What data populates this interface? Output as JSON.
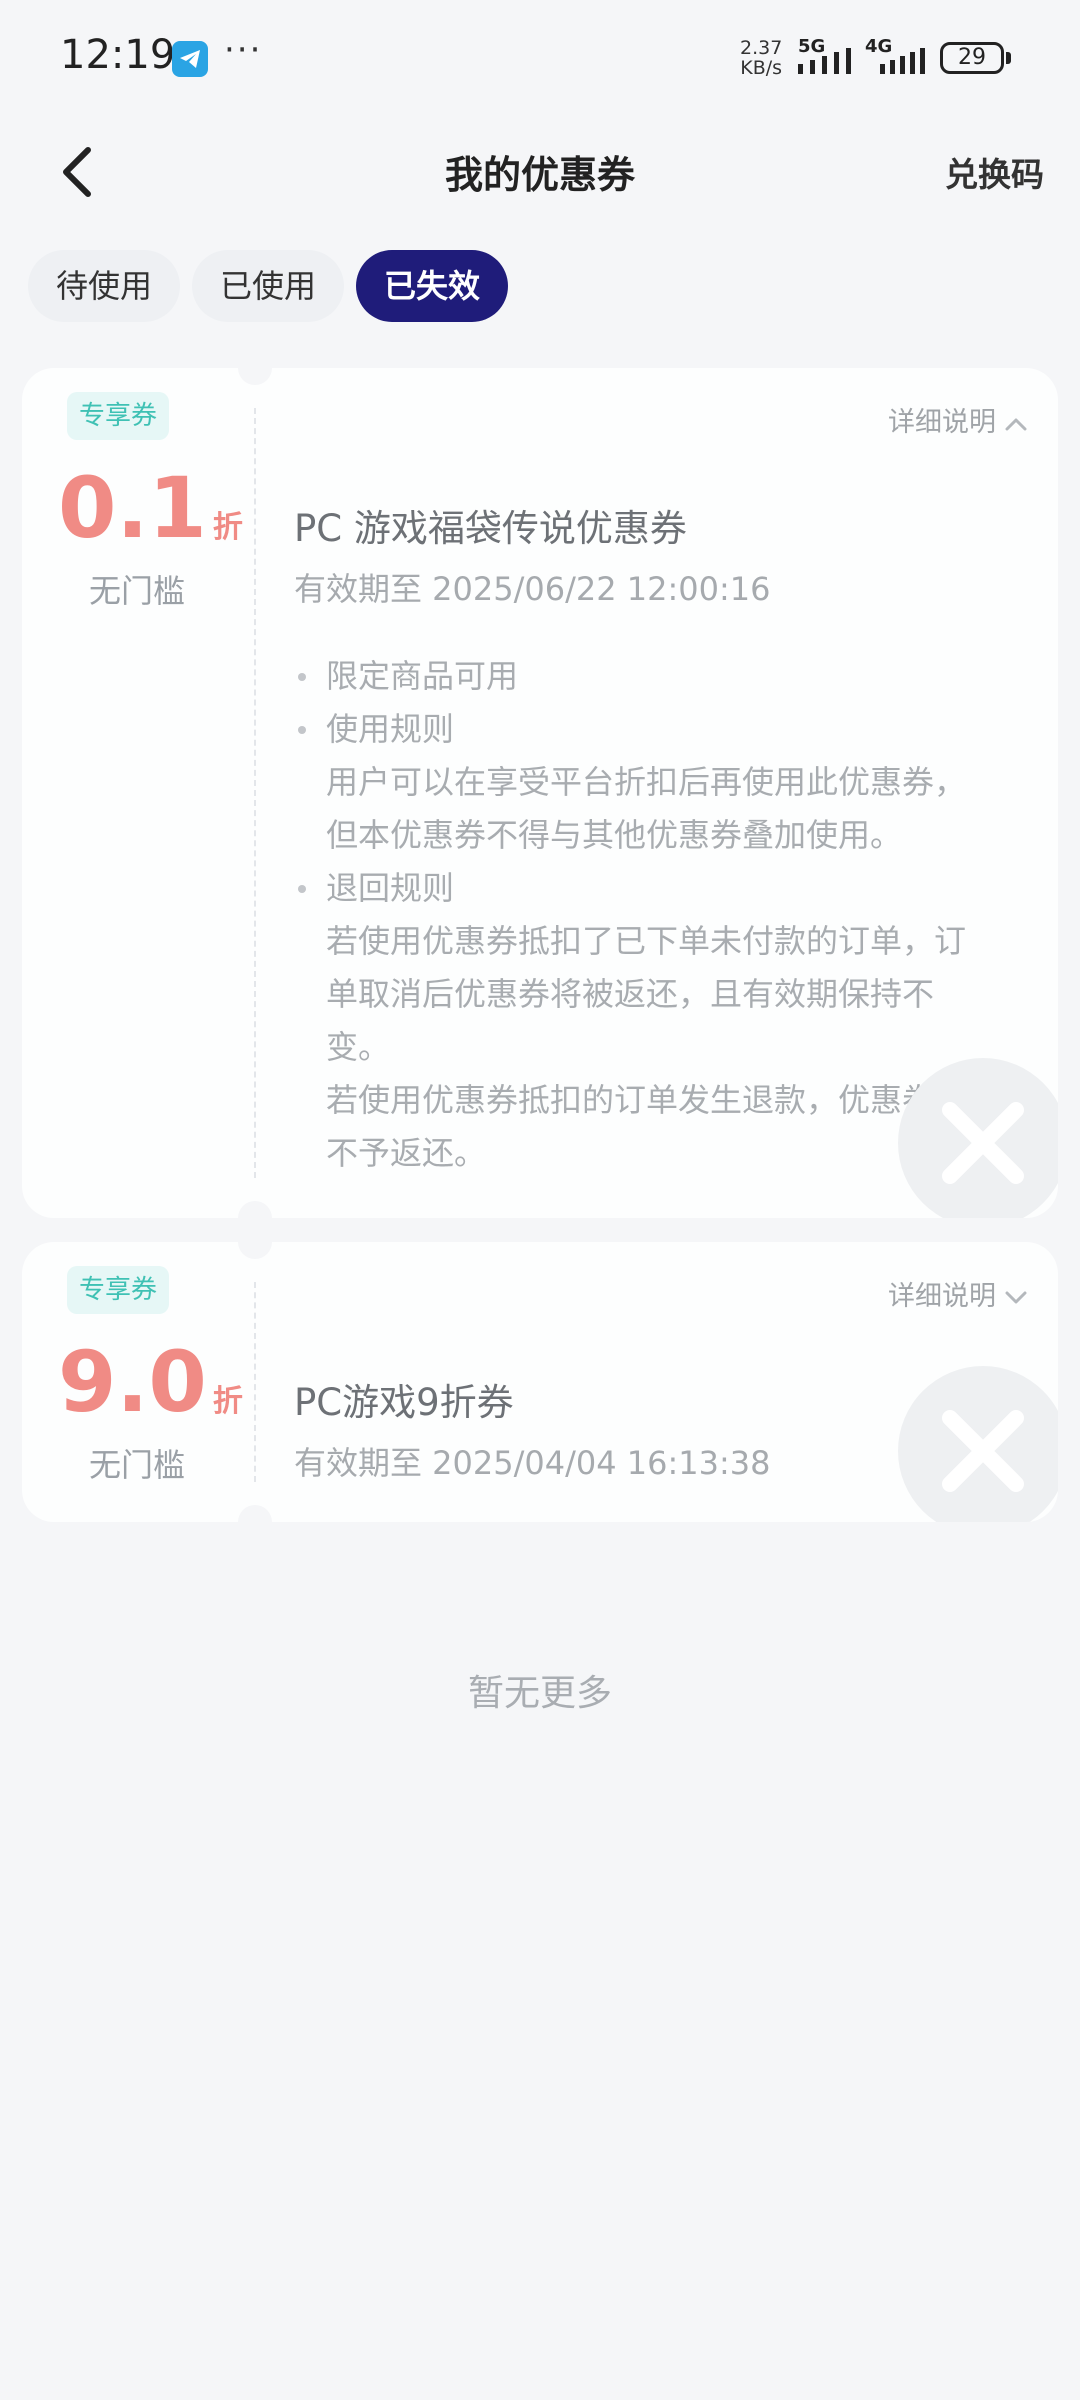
{
  "status_bar": {
    "time": "12:19",
    "more": "···",
    "speed_value": "2.37",
    "speed_unit": "KB/s",
    "net_1": "5G",
    "net_2": "4G",
    "battery": "29"
  },
  "header": {
    "title": "我的优惠券",
    "redeem_label": "兑换码"
  },
  "tabs": [
    {
      "label": "待使用",
      "active": false
    },
    {
      "label": "已使用",
      "active": false
    },
    {
      "label": "已失效",
      "active": true
    }
  ],
  "coupons": [
    {
      "badge": "专享券",
      "discount_value": "0.1",
      "discount_unit": "折",
      "threshold": "无门槛",
      "detail_label": "详细说明",
      "detail_expanded": true,
      "title": "PC 游戏福袋传说优惠券",
      "expiry": "有效期至 2025/06/22 12:00:16",
      "rules": [
        {
          "heading": "限定商品可用",
          "lines": []
        },
        {
          "heading": "使用规则",
          "lines": [
            "用户可以在享受平台折扣后再使用此优惠券，",
            "但本优惠券不得与其他优惠券叠加使用。"
          ]
        },
        {
          "heading": "退回规则",
          "lines": [
            "若使用优惠券抵扣了已下单未付款的订单，订",
            "单取消后优惠券将被返还，且有效期保持不",
            "变。",
            "若使用优惠券抵扣的订单发生退款，优惠券将",
            "不予返还。"
          ]
        }
      ]
    },
    {
      "badge": "专享券",
      "discount_value": "9.0",
      "discount_unit": "折",
      "threshold": "无门槛",
      "detail_label": "详细说明",
      "detail_expanded": false,
      "title": "PC游戏9折券",
      "expiry": "有效期至 2025/04/04 16:13:38"
    }
  ],
  "footer": {
    "no_more": "暂无更多"
  },
  "colors": {
    "accent": "#1f1c7a",
    "discount": "#f08b85",
    "badge_text": "#3fc1b4",
    "badge_bg": "#e6f7f6",
    "background": "#f5f6f8"
  },
  "icons": {
    "back": "chevron-left-icon",
    "app": "telegram-icon",
    "detail_open": "chevron-up-icon",
    "detail_closed": "chevron-down-icon",
    "expired": "close-icon"
  }
}
